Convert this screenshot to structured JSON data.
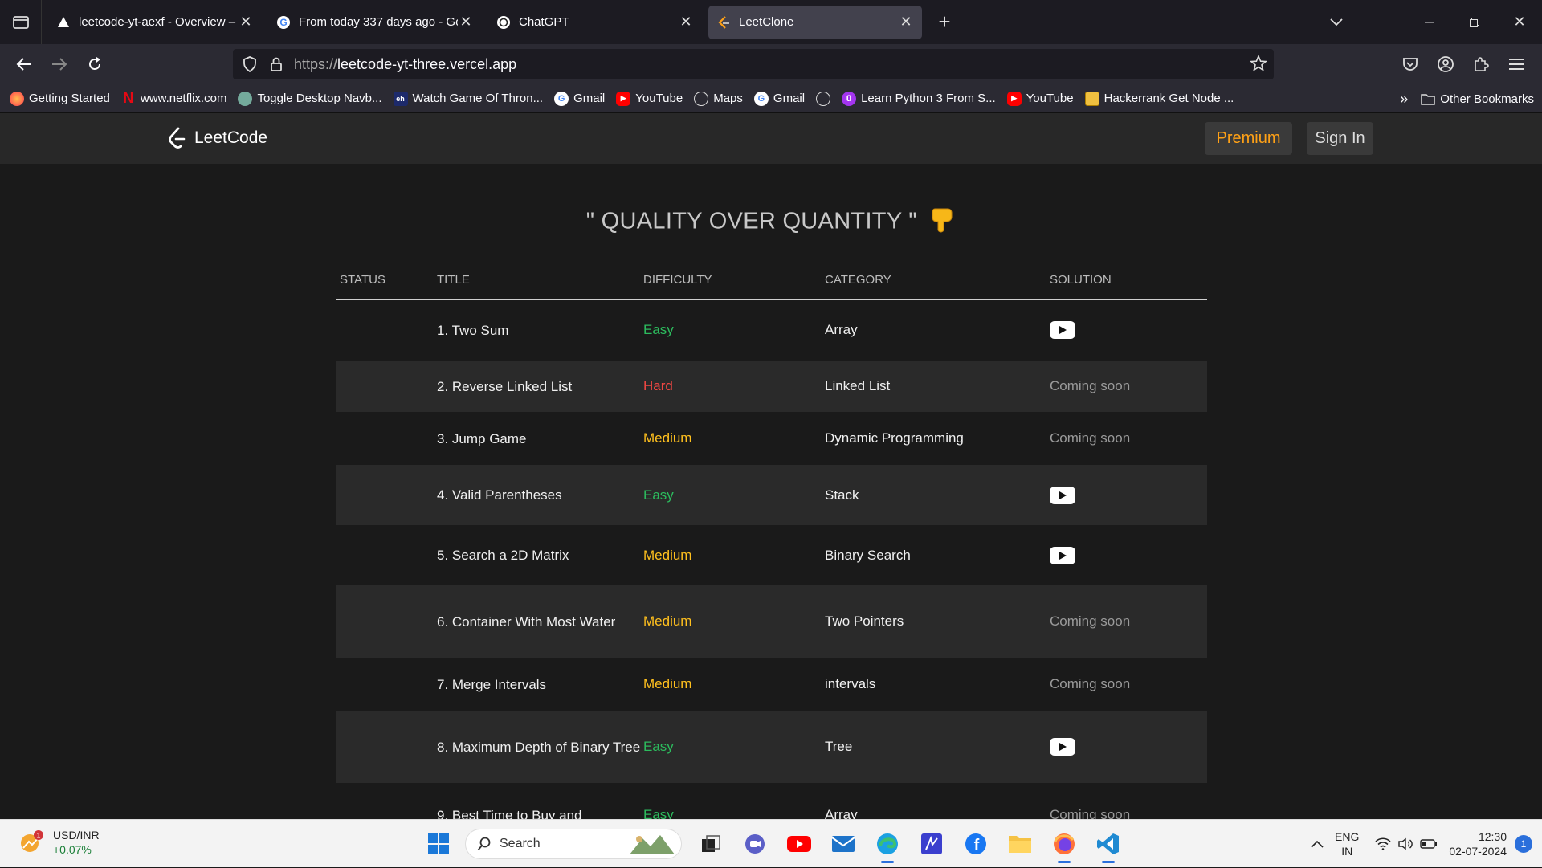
{
  "browser": {
    "tabs": [
      {
        "title": "leetcode-yt-aexf - Overview – V",
        "active": false
      },
      {
        "title": "From today 337 days ago - Goo",
        "active": false
      },
      {
        "title": "ChatGPT",
        "active": false
      },
      {
        "title": "LeetClone",
        "active": true
      }
    ],
    "url_protocol": "https://",
    "url_host": "leetcode-yt-three.vercel.app",
    "bookmarks": [
      "Getting Started",
      "www.netflix.com",
      "Toggle Desktop Navb...",
      "Watch Game Of Thron...",
      "Gmail",
      "YouTube",
      "Maps",
      "Gmail",
      "",
      "Learn Python 3 From S...",
      "YouTube",
      "Hackerrank Get Node ..."
    ],
    "other_bookmarks": "Other Bookmarks"
  },
  "site": {
    "logo_text": "LeetCode",
    "premium_label": "Premium",
    "signin_label": "Sign In",
    "headline": "\" QUALITY OVER QUANTITY \"",
    "headline_emoji": "👇"
  },
  "table": {
    "headers": [
      "STATUS",
      "TITLE",
      "DIFFICULTY",
      "CATEGORY",
      "SOLUTION"
    ],
    "rows": [
      {
        "title": "1. Two Sum",
        "difficulty": "Easy",
        "category": "Array",
        "solution": "youtube"
      },
      {
        "title": "2. Reverse Linked List",
        "difficulty": "Hard",
        "category": "Linked List",
        "solution": "Coming soon"
      },
      {
        "title": "3. Jump Game",
        "difficulty": "Medium",
        "category": "Dynamic Programming",
        "solution": "Coming soon"
      },
      {
        "title": "4. Valid Parentheses",
        "difficulty": "Easy",
        "category": "Stack",
        "solution": "youtube"
      },
      {
        "title": "5. Search a 2D Matrix",
        "difficulty": "Medium",
        "category": "Binary Search",
        "solution": "youtube"
      },
      {
        "title": "6. Container With Most Water",
        "difficulty": "Medium",
        "category": "Two Pointers",
        "solution": "Coming soon"
      },
      {
        "title": "7. Merge Intervals",
        "difficulty": "Medium",
        "category": "intervals",
        "solution": "Coming soon"
      },
      {
        "title": "8. Maximum Depth of Binary Tree",
        "difficulty": "Easy",
        "category": "Tree",
        "solution": "youtube"
      },
      {
        "title": "9. Best Time to Buy and",
        "difficulty": "Easy",
        "category": "Array",
        "solution": "Coming soon"
      }
    ]
  },
  "taskbar": {
    "widget_title": "USD/INR",
    "widget_value": "+0.07%",
    "widget_badge": "1",
    "search_placeholder": "Search",
    "lang_line1": "ENG",
    "lang_line2": "IN",
    "time": "12:30",
    "date": "02-07-2024",
    "notification_count": "1"
  },
  "colors": {
    "easy": "#2cbb5d",
    "medium": "#ffc01e",
    "hard": "#ef4743",
    "premium": "#ffa116"
  }
}
